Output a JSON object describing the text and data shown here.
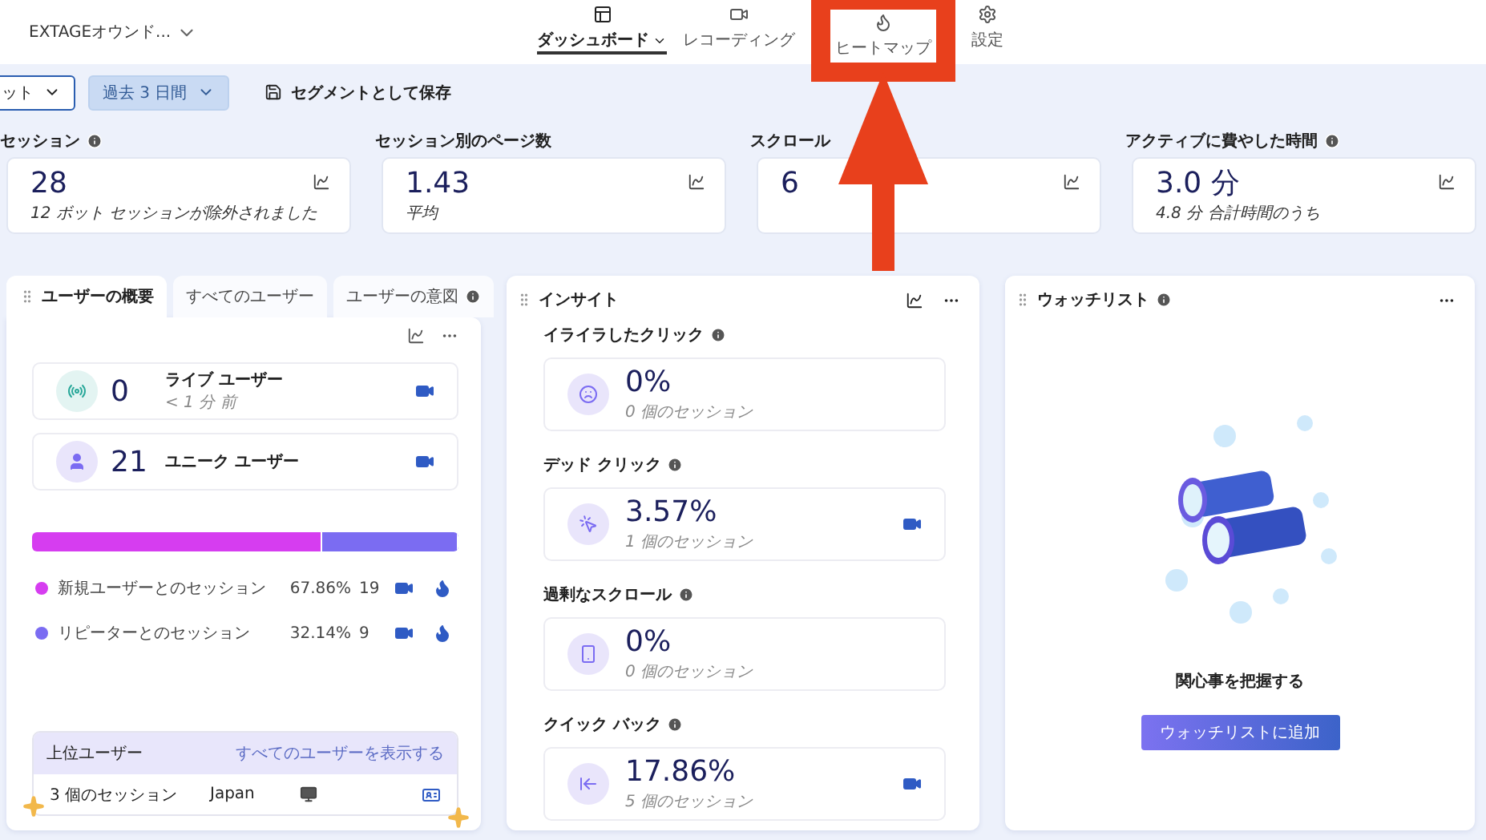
{
  "header": {
    "project": "EXTAGEオウンド...",
    "nav": [
      {
        "label": "ダッシュボード",
        "selected": true,
        "menu": true
      },
      {
        "label": "レコーディング",
        "selected": false,
        "menu": false
      },
      {
        "label": "ヒートマップ",
        "selected": false,
        "menu": false
      },
      {
        "label": "設定",
        "selected": false,
        "menu": false
      }
    ]
  },
  "filters": [
    {
      "label": "ット",
      "selected": false
    },
    {
      "label": "過去 3 日間",
      "selected": true
    }
  ],
  "save_segment": "セグメントとして保存",
  "metrics": [
    {
      "label": "セッション",
      "info": true,
      "value": "28",
      "note": "12 ボット セッションが除外されました"
    },
    {
      "label": "セッション別のページ数",
      "info": false,
      "value": "1.43",
      "note": "平均"
    },
    {
      "label": "スクロール",
      "info": false,
      "value": "6"
    },
    {
      "label": "アクティブに費やした時間",
      "info": true,
      "value": "3.0 分",
      "note": "4.8 分 合計時間のうち"
    }
  ],
  "user_panel": {
    "tabs": [
      {
        "label": "ユーザーの概要",
        "selected": true,
        "info": false
      },
      {
        "label": "すべてのユーザー",
        "selected": false,
        "info": false
      },
      {
        "label": "ユーザーの意図",
        "selected": false,
        "info": true
      }
    ],
    "stats": [
      {
        "kind": "live",
        "value": "0",
        "title": "ライブ ユーザー",
        "note": "< 1 分 前"
      },
      {
        "kind": "unique",
        "value": "21",
        "title": "ユニーク ユーザー"
      }
    ],
    "segments": [
      {
        "label": "新規ユーザーとのセッション",
        "color": "#d63df0",
        "level": 0.6786,
        "percent": "67.86%",
        "count": "19"
      },
      {
        "label": "リピーターとのセッション",
        "color": "#7b6cf2",
        "level": 0.3214,
        "percent": "32.14%",
        "count": "9"
      }
    ],
    "top_users": {
      "title": "上位ユーザー",
      "link": "すべてのユーザーを表示する",
      "rows": [
        {
          "sessions": "3 個のセッション",
          "country": "Japan"
        }
      ]
    }
  },
  "insights": {
    "title": "インサイト",
    "items": [
      {
        "kind": "frustrated",
        "title": "イライラしたクリック",
        "value": "0%",
        "note": "0 個のセッション",
        "recording": false
      },
      {
        "kind": "dead",
        "title": "デッド クリック",
        "value": "3.57%",
        "note": "1 個のセッション",
        "recording": true
      },
      {
        "kind": "scroll",
        "title": "過剰なスクロール",
        "value": "0%",
        "note": "0 個のセッション",
        "recording": false
      },
      {
        "kind": "back",
        "title": "クイック バック",
        "value": "17.86%",
        "note": "5 個のセッション",
        "recording": true
      }
    ]
  },
  "watchlist": {
    "title": "ウォッチリスト",
    "message": "関心事を把握する",
    "button": "ウォッチリストに追加"
  }
}
